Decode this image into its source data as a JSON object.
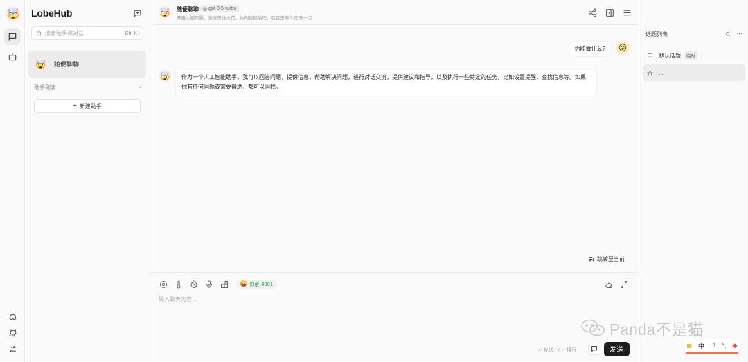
{
  "app": {
    "brand": "LobeHub"
  },
  "sidebar": {
    "search_placeholder": "搜索助手和对话...",
    "search_shortcut": "Ctrl K",
    "sessions": [
      {
        "name": "随便聊聊",
        "avatar": "🤯"
      }
    ],
    "section_title": "助手列表",
    "add_assistant_label": "新建助手"
  },
  "header": {
    "title": "随便聊聊",
    "model": "gpt-3.5-turbo",
    "description": "开启大脑风暴，激发思维火花。你的智能助理，在这里与你交流一切"
  },
  "messages": [
    {
      "role": "user",
      "avatar": "😜",
      "text": "你能做什么?"
    },
    {
      "role": "assistant",
      "avatar": "🤯",
      "text": "作为一个人工智能助手，我可以回答问题，提供信息，帮助解决问题，进行对话交流，提供建议和指导，以及执行一些特定的任务，比如设置提醒，查找信息等。如果你有任何问题或需要帮助，都可以问我。"
    }
  ],
  "jump_label": "跳转至当前",
  "composer": {
    "token_label": "剩余",
    "token_value": "4001",
    "placeholder": "输入聊天内容...",
    "hint": "↵ 发送 / ⇧↵ 换行",
    "send_label": "发送"
  },
  "topics": {
    "title": "话题列表",
    "items": [
      {
        "label": "默认话题",
        "badge": "临时"
      },
      {
        "label": "..."
      }
    ]
  },
  "watermark": "Panda不是猫",
  "ime": {
    "lang": "中"
  },
  "colors": {
    "accent": "#1f1f1f",
    "token_green": "#2a9d4b",
    "ime_underline": "#f05a3a"
  }
}
